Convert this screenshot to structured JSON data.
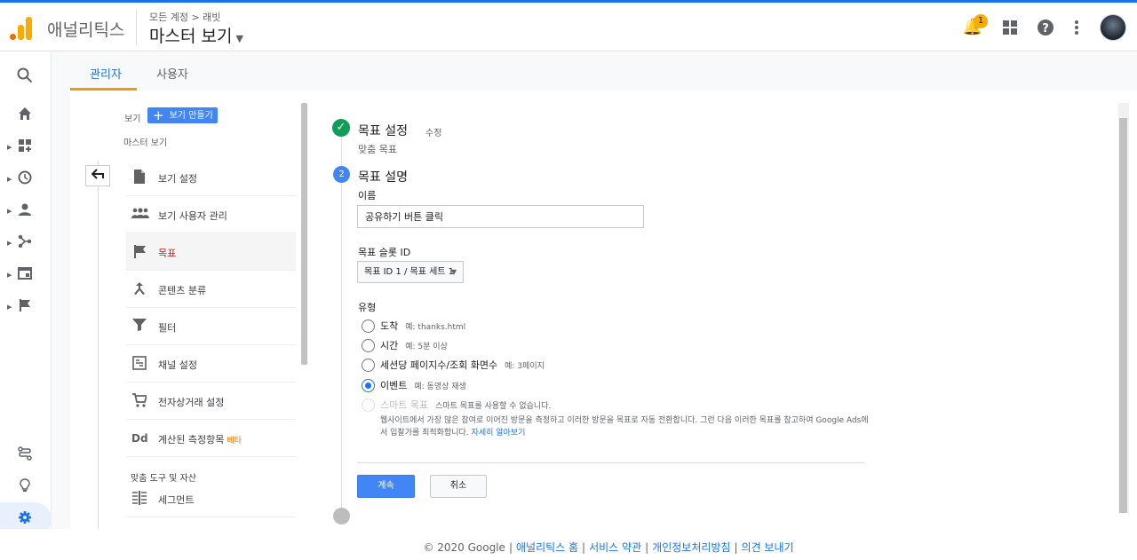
{
  "header": {
    "app_name": "애널리틱스",
    "breadcrumb": "모든 계정 > 래빗",
    "view_title": "마스터 보기",
    "notification_count": "1"
  },
  "tabs": [
    {
      "label": "관리자",
      "active": true
    },
    {
      "label": "사용자",
      "active": false
    }
  ],
  "admin": {
    "view_label": "보기",
    "create_view": "보기 만들기",
    "master_view_label": "마스터 보기",
    "menu": [
      {
        "label": "보기 설정",
        "icon": "document-icon"
      },
      {
        "label": "보기 사용자 관리",
        "icon": "people-icon"
      },
      {
        "label": "목표",
        "icon": "flag-icon",
        "active": true
      },
      {
        "label": "콘텐츠 분류",
        "icon": "merge-icon"
      },
      {
        "label": "필터",
        "icon": "filter-icon"
      },
      {
        "label": "채널 설정",
        "icon": "channel-icon"
      },
      {
        "label": "전자상거래 설정",
        "icon": "cart-icon"
      },
      {
        "label": "계산된 측정항목",
        "icon": "dd-icon",
        "beta": "베타"
      },
      {
        "label": "세그먼트",
        "icon": "segment-icon"
      }
    ],
    "section_label": "맞춤 도구 및 자산"
  },
  "goal": {
    "step1": {
      "title": "목표 설정",
      "edit": "수정",
      "subtitle": "맞춤 목표"
    },
    "step2": {
      "number": "2",
      "title": "목표 설명",
      "name_label": "이름",
      "name_value": "공유하기 버튼 클릭",
      "slot_label": "목표 슬롯 ID",
      "slot_value": "목표 ID 1 / 목표 세트 1",
      "type_label": "유형",
      "types": [
        {
          "label": "도착",
          "example": "예: thanks.html",
          "checked": false
        },
        {
          "label": "시간",
          "example": "예: 5분 이상",
          "checked": false
        },
        {
          "label": "세션당 페이지수/조회 화면수",
          "example": "예: 3페이지",
          "checked": false
        },
        {
          "label": "이벤트",
          "example": "예: 동영상 재생",
          "checked": true
        },
        {
          "label": "스마트 목표",
          "example": "스마트 목표를 사용할 수 없습니다.",
          "checked": false,
          "disabled": true
        }
      ],
      "smart_desc": "웹사이트에서 가장 많은 참여로 이어진 방문을 측정하고 이러한 방문을 목표로 자동 전환합니다. 그런 다음 이러한 목표를 참고하여 Google Ads에서 입찰가를 최적화합니다.",
      "smart_link": "자세히 알아보기",
      "continue": "계속",
      "cancel": "취소"
    }
  },
  "footer": {
    "copyright": "© 2020 Google",
    "links": [
      "애널리틱스 홈",
      "서비스 약관",
      "개인정보처리방침",
      "의견 보내기"
    ]
  }
}
